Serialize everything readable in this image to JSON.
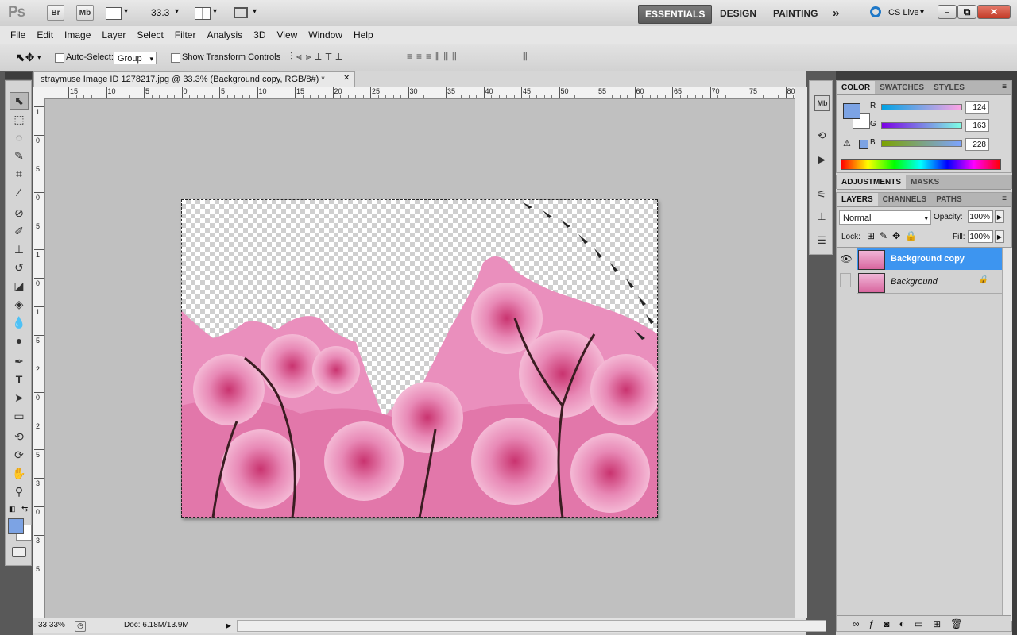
{
  "app": {
    "logo": "Ps",
    "bridge_label": "Br",
    "minibridge_label": "Mb",
    "zoom_value": "33.3",
    "workspaces": [
      "ESSENTIALS",
      "DESIGN",
      "PAINTING"
    ],
    "more_workspaces": "»",
    "cs_live": "CS Live",
    "window_controls": {
      "minimize": "–",
      "restore": "⧉",
      "close": "✕"
    }
  },
  "menu": [
    "File",
    "Edit",
    "Image",
    "Layer",
    "Select",
    "Filter",
    "Analysis",
    "3D",
    "View",
    "Window",
    "Help"
  ],
  "options": {
    "auto_select_label": "Auto-Select:",
    "auto_select_value": "Group",
    "transform_label": "Show Transform Controls"
  },
  "document": {
    "tab_title": "straymuse Image ID 1278217.jpg @ 33.3% (Background copy, RGB/8#) *",
    "close": "✕",
    "ruler_h": [
      "15",
      "10",
      "5",
      "0",
      "5",
      "10",
      "15",
      "20",
      "25",
      "30",
      "35",
      "40",
      "45",
      "50",
      "55",
      "60",
      "65",
      "70",
      "75",
      "80"
    ],
    "ruler_v": [
      "1",
      "0",
      "5",
      "0",
      "5",
      "1",
      "0",
      "1",
      "5",
      "2",
      "0",
      "2",
      "5",
      "3",
      "0",
      "3",
      "5"
    ],
    "zoom_status": "33.33%",
    "doc_size": "Doc: 6.18M/13.9M"
  },
  "color_panel": {
    "tabs": [
      "COLOR",
      "SWATCHES",
      "STYLES"
    ],
    "fg_color": "#7ca3e4",
    "r_label": "R",
    "g_label": "G",
    "b_label": "B",
    "r": "124",
    "g": "163",
    "b": "228"
  },
  "adjustments_panel": {
    "tabs": [
      "ADJUSTMENTS",
      "MASKS"
    ]
  },
  "layers_panel": {
    "tabs": [
      "LAYERS",
      "CHANNELS",
      "PATHS"
    ],
    "blend_mode": "Normal",
    "opacity_label": "Opacity:",
    "opacity": "100%",
    "lock_label": "Lock:",
    "fill_label": "Fill:",
    "fill": "100%",
    "layers": [
      {
        "name": "Background copy",
        "selected": true,
        "visible": true
      },
      {
        "name": "Background",
        "selected": false,
        "visible": false,
        "locked": true
      }
    ]
  }
}
